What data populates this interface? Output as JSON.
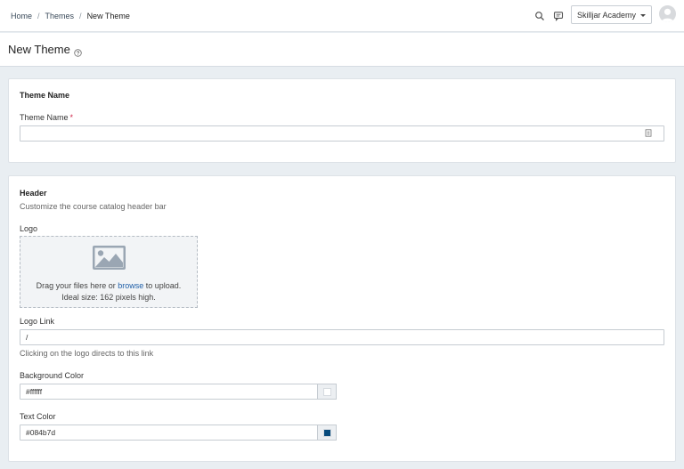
{
  "breadcrumb": {
    "items": [
      {
        "label": "Home"
      },
      {
        "label": "Themes"
      },
      {
        "label": "New Theme"
      }
    ],
    "separator": "/"
  },
  "topbar": {
    "icons": [
      "search-icon",
      "comment-icon"
    ],
    "org_select": {
      "value": "Skilljar Academy"
    }
  },
  "page": {
    "title": "New Theme",
    "help_icon": "question-circle-icon"
  },
  "theme_name_section": {
    "title": "Theme Name",
    "field_label": "Theme Name",
    "required_marker": "*",
    "value": ""
  },
  "header_section": {
    "title": "Header",
    "description": "Customize the course catalog header bar",
    "logo": {
      "label": "Logo",
      "drop_prefix": "Drag your files here or",
      "browse_label": "browse",
      "drop_suffix": "to upload.",
      "ideal_size": "Ideal size: 162 pixels high."
    },
    "logo_link": {
      "label": "Logo Link",
      "value": "/",
      "help": "Clicking on the logo directs to this link"
    },
    "background_color": {
      "label": "Background Color",
      "value": "#ffffff",
      "swatch": "#ffffff"
    },
    "text_color": {
      "label": "Text Color",
      "value": "#084b7d",
      "swatch": "#084b7d"
    }
  }
}
